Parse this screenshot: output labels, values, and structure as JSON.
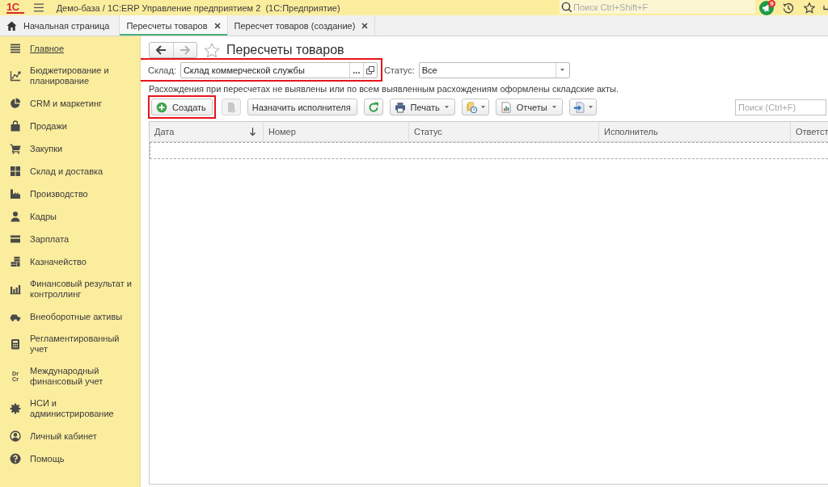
{
  "top_bar": {
    "logo": "1С",
    "title": "Демо-база / 1С:ERP Управление предприятием 2  (1С:Предприятие)",
    "search": {
      "placeholder": "Поиск Ctrl+Shift+F"
    },
    "notifications": {
      "count": "9"
    }
  },
  "tabs": [
    {
      "kind": "home",
      "label": "Начальная страница",
      "selected": false,
      "closable": false
    },
    {
      "kind": "document",
      "label": "Пересчеты товаров",
      "selected": true,
      "closable": true
    },
    {
      "kind": "document",
      "label": "Пересчет товаров (создание)",
      "selected": false,
      "closable": true
    }
  ],
  "sidebar": {
    "items": [
      {
        "label": "Главное",
        "selected": true
      },
      {
        "label": "Бюджетирование и планирование",
        "selected": false
      },
      {
        "label": "CRM и маркетинг",
        "selected": false
      },
      {
        "label": "Продажи",
        "selected": false
      },
      {
        "label": "Закупки",
        "selected": false
      },
      {
        "label": "Склад и доставка",
        "selected": false
      },
      {
        "label": "Производство",
        "selected": false
      },
      {
        "label": "Кадры",
        "selected": false
      },
      {
        "label": "Зарплата",
        "selected": false
      },
      {
        "label": "Казначейство",
        "selected": false
      },
      {
        "label": "Финансовый результат и контроллинг",
        "selected": false
      },
      {
        "label": "Внеоборотные активы",
        "selected": false
      },
      {
        "label": "Регламентированный учет",
        "selected": false
      },
      {
        "label": "Международный финансовый учет",
        "selected": false,
        "icon_text": [
          "Dr",
          "Cr"
        ]
      },
      {
        "label": "НСИ и администрирование",
        "selected": false
      },
      {
        "label": "Личный кабинет",
        "selected": false
      },
      {
        "label": "Помощь",
        "selected": false
      }
    ]
  },
  "form": {
    "nav": [
      {
        "kind": "back",
        "disabled": false
      },
      {
        "kind": "forward",
        "disabled": true
      }
    ],
    "favorite": false,
    "title": "Пересчеты товаров",
    "filters": [
      {
        "kind": "reference",
        "label": "Склад:",
        "value": "Склад коммерческой службы",
        "select_button": "...",
        "highlighted": true
      },
      {
        "kind": "dropdown",
        "label": "Статус:",
        "value": "Все",
        "highlighted": false
      }
    ],
    "info": "Расхождения при пересчетах не выявлены или по всем выявленным расхождениям оформлены складские акты.",
    "toolbar": [
      {
        "kind": "icon-label",
        "label": "Создать",
        "disabled": false,
        "dropdown": false,
        "highlighted": true
      },
      {
        "kind": "icon",
        "disabled": true,
        "dropdown": false,
        "highlighted": false
      },
      {
        "kind": "label",
        "label": "Назначить исполнителя",
        "disabled": false,
        "dropdown": false,
        "highlighted": false
      },
      {
        "kind": "icon",
        "disabled": false,
        "dropdown": false,
        "highlighted": false
      },
      {
        "kind": "icon-label",
        "label": "Печать",
        "disabled": false,
        "dropdown": true,
        "highlighted": false
      },
      {
        "kind": "icon",
        "disabled": false,
        "dropdown": true,
        "highlighted": false
      },
      {
        "kind": "icon-label",
        "label": "Отчеты",
        "disabled": false,
        "dropdown": true,
        "highlighted": false
      },
      {
        "kind": "icon",
        "disabled": false,
        "dropdown": true,
        "highlighted": false
      }
    ],
    "search": {
      "placeholder": "Поиск (Ctrl+F)"
    },
    "table": {
      "columns": [
        {
          "label": "Дата",
          "sorted": true
        },
        {
          "label": "Номер",
          "sorted": false
        },
        {
          "label": "Статус",
          "sorted": false
        },
        {
          "label": "Исполнитель",
          "sorted": false
        },
        {
          "label": "Ответст",
          "sorted": false
        }
      ]
    }
  }
}
